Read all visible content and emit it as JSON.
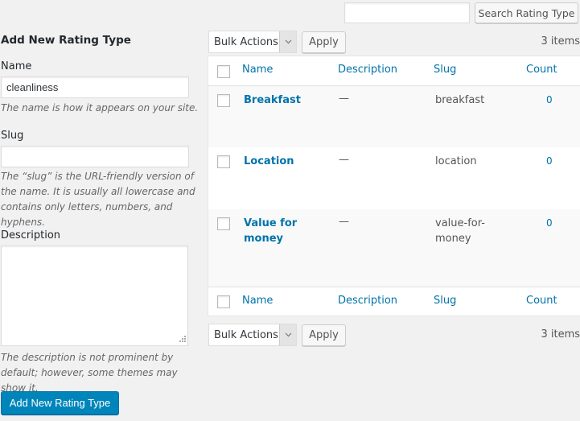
{
  "search": {
    "input_value": "",
    "button_label": "Search Rating Type"
  },
  "form": {
    "title": "Add New Rating Type",
    "name_label": "Name",
    "name_value": "cleanliness",
    "name_help": "The name is how it appears on your site.",
    "slug_label": "Slug",
    "slug_value": "",
    "slug_help": "The “slug” is the URL-friendly version of the name. It is usually all lowercase and contains only letters, numbers, and hyphens.",
    "description_label": "Description",
    "description_value": "",
    "description_help": "The description is not prominent by default; however, some themes may show it.",
    "submit_label": "Add New Rating Type"
  },
  "tablenav": {
    "bulk_actions_label": "Bulk Actions",
    "apply_label": "Apply",
    "items_count": "3 items",
    "dropdown_icon": "chevron-down-icon"
  },
  "table": {
    "columns": [
      "Name",
      "Description",
      "Slug",
      "Count"
    ],
    "rows": [
      {
        "name": "Breakfast",
        "description": "—",
        "slug": "breakfast",
        "count": "0"
      },
      {
        "name": "Location",
        "description": "—",
        "slug": "location",
        "count": "0"
      },
      {
        "name": "Value for money",
        "description": "—",
        "slug": "value-for-money",
        "count": "0"
      }
    ]
  },
  "colors": {
    "link": "#0073aa",
    "primary_button": "#0085ba",
    "background": "#f1f1f1"
  }
}
